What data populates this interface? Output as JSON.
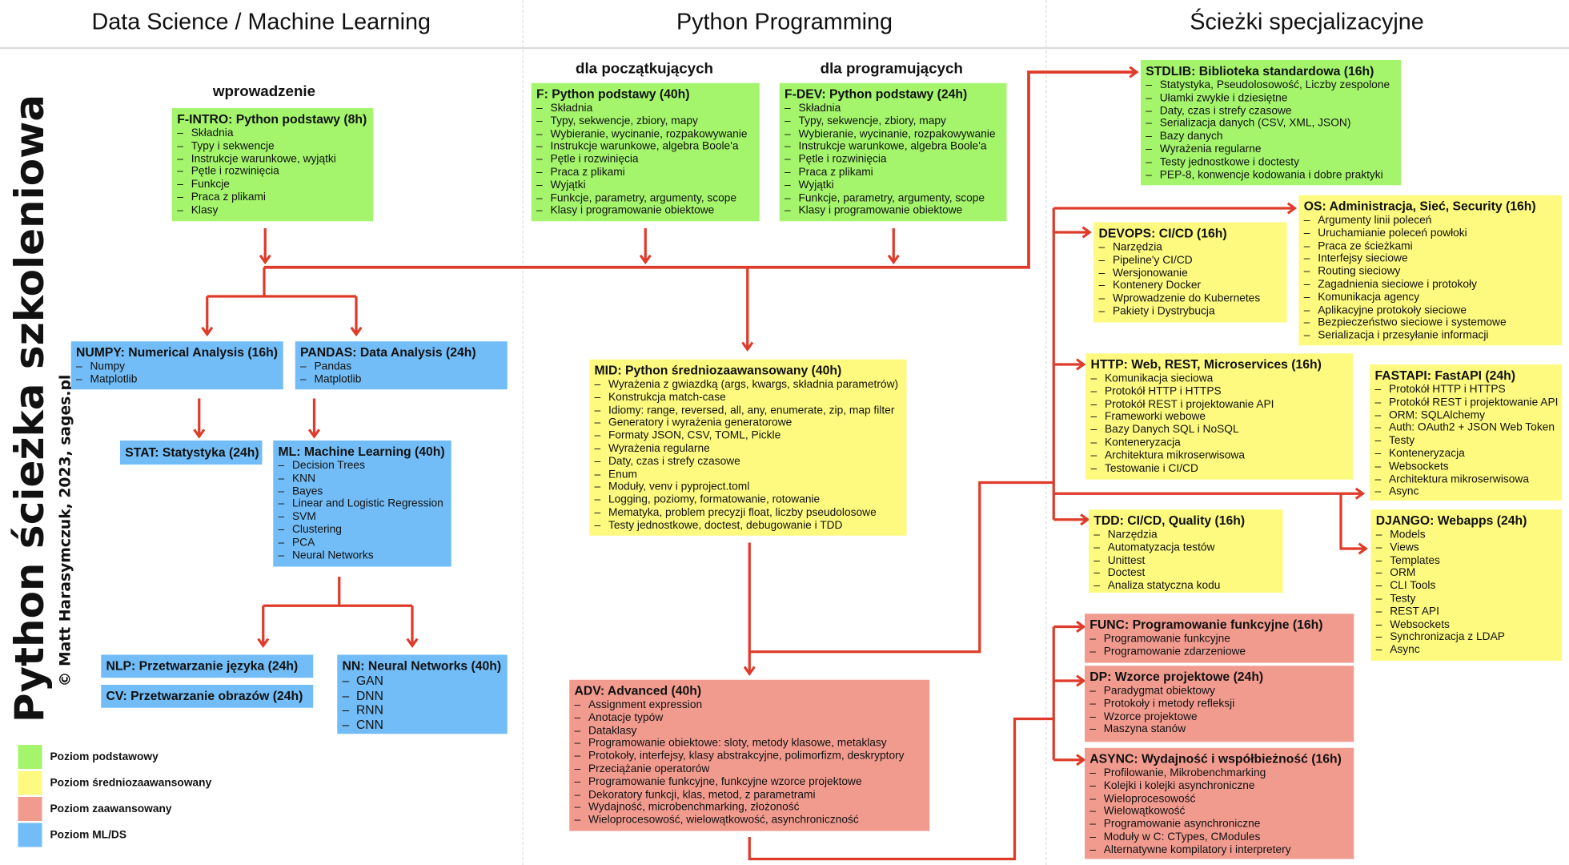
{
  "headers": {
    "data_science": "Data Science / Machine Learning",
    "python": "Python Programming",
    "specializations": "Ścieżki specjalizacyjne"
  },
  "subheaders": {
    "intro": "wprowadzenie",
    "beginners": "dla początkujących",
    "programmers": "dla programujących"
  },
  "side_title": "Python ścieżka szkoleniowa",
  "copyright": "© Matt Harasymczuk, 2023, sages.pl",
  "colors": {
    "basic": "#a4f56c",
    "intermediate": "#fdfa7f",
    "advanced": "#f19b8f",
    "ml_ds": "#72bdf7",
    "arrow": "#df3b2a"
  },
  "legend": [
    {
      "level": "basic",
      "label": "Poziom podstawowy"
    },
    {
      "level": "mid",
      "label": "Poziom średniozaawansowany"
    },
    {
      "level": "adv",
      "label": "Poziom zaawansowany"
    },
    {
      "level": "ml",
      "label": "Poziom ML/DS"
    }
  ],
  "courses": [
    {
      "id": "fintro",
      "level": "basic",
      "title": "F-INTRO: Python podstawy (8h)",
      "items": [
        "Składnia",
        "Typy i sekwencje",
        "Instrukcje warunkowe, wyjątki",
        "Pętle i rozwinięcia",
        "Funkcje",
        "Praca z plikami",
        "Klasy"
      ]
    },
    {
      "id": "f",
      "level": "basic",
      "title": "F: Python podstawy (40h)",
      "items": [
        "Składnia",
        "Typy, sekwencje, zbiory, mapy",
        "Wybieranie, wycinanie, rozpakowywanie",
        "Instrukcje warunkowe, algebra Boole'a",
        "Pętle i rozwinięcia",
        "Praca z plikami",
        "Wyjątki",
        "Funkcje, parametry, argumenty, scope",
        "Klasy i programowanie obiektowe"
      ]
    },
    {
      "id": "fdev",
      "level": "basic",
      "title": "F-DEV: Python podstawy (24h)",
      "items": [
        "Składnia",
        "Typy, sekwencje, zbiory, mapy",
        "Wybieranie, wycinanie, rozpakowywanie",
        "Instrukcje warunkowe, algebra Boole'a",
        "Pętle i rozwinięcia",
        "Praca z plikami",
        "Wyjątki",
        "Funkcje, parametry, argumenty, scope",
        "Klasy i programowanie obiektowe"
      ]
    },
    {
      "id": "stdlib",
      "level": "basic",
      "title": "STDLIB: Biblioteka standardowa (16h)",
      "items": [
        "Statystyka, Pseudolosowość, Liczby zespolone",
        "Ułamki zwykłe i dziesiętne",
        "Daty, czas i strefy czasowe",
        "Serializacja danych (CSV, XML, JSON)",
        "Bazy danych",
        "Wyrażenia regularne",
        "Testy jednostkowe i doctesty",
        "PEP-8, konwencje kodowania i dobre praktyki"
      ]
    },
    {
      "id": "os",
      "level": "mid",
      "title": "OS: Administracja, Sieć, Security (16h)",
      "items": [
        "Argumenty linii poleceń",
        "Uruchamianie poleceń powłoki",
        "Praca ze ścieżkami",
        "Interfejsy sieciowe",
        "Routing sieciowy",
        "Zagadnienia sieciowe i protokoły",
        "Komunikacja agency",
        "Aplikacyjne protokoły sieciowe",
        "Bezpieczeństwo sieciowe i systemowe",
        "Serializacja i przesyłanie informacji"
      ]
    },
    {
      "id": "devops",
      "level": "mid",
      "title": "DEVOPS: CI/CD (16h)",
      "items": [
        "Narzędzia",
        "Pipeline'y CI/CD",
        "Wersjonowanie",
        "Kontenery Docker",
        "Wprowadzenie do Kubernetes",
        "Pakiety i Dystrybucja"
      ]
    },
    {
      "id": "http",
      "level": "mid",
      "title": "HTTP: Web, REST, Microservices (16h)",
      "items": [
        "Komunikacja sieciowa",
        "Protokół HTTP i HTTPS",
        "Protokół REST i projektowanie API",
        "Frameworki webowe",
        "Bazy Danych SQL i NoSQL",
        "Konteneryzacja",
        "Architektura mikroserwisowa",
        "Testowanie i CI/CD"
      ]
    },
    {
      "id": "fastapi",
      "level": "mid",
      "title": "FASTAPI: FastAPI (24h)",
      "items": [
        "Protokół HTTP i HTTPS",
        "Protokół REST i projektowanie API",
        "ORM: SQLAlchemy",
        "Auth: OAuth2 + JSON Web Token",
        "Testy",
        "Konteneryzacja",
        "Websockets",
        "Architektura mikroserwisowa",
        "Async"
      ]
    },
    {
      "id": "tdd",
      "level": "mid",
      "title": "TDD: CI/CD, Quality (16h)",
      "items": [
        "Narzędzia",
        "Automatyzacja testów",
        "Unittest",
        "Doctest",
        "Analiza statyczna kodu"
      ]
    },
    {
      "id": "django",
      "level": "mid",
      "title": "DJANGO: Webapps (24h)",
      "items": [
        "Models",
        "Views",
        "Templates",
        "ORM",
        "CLI Tools",
        "Testy",
        "REST API",
        "Websockets",
        "Synchronizacja z LDAP",
        "Async"
      ]
    },
    {
      "id": "func",
      "level": "adv",
      "title": "FUNC: Programowanie funkcyjne (16h)",
      "items": [
        "Programowanie funkcyjne",
        "Programowanie zdarzeniowe"
      ]
    },
    {
      "id": "dp",
      "level": "adv",
      "title": "DP: Wzorce projektowe (24h)",
      "items": [
        "Paradygmat obiektowy",
        "Protokoły i metody refleksji",
        "Wzorce projektowe",
        "Maszyna stanów"
      ]
    },
    {
      "id": "async",
      "level": "adv",
      "title": "ASYNC: Wydajność i współbieżność (16h)",
      "items": [
        "Profilowanie, Mikrobenchmarking",
        "Kolejki i kolejki asynchroniczne",
        "Wieloprocesowość",
        "Wielowątkowość",
        "Programowanie asynchroniczne",
        "Moduły w C: CTypes, CModules",
        "Alternatywne kompilatory i interpretery"
      ]
    },
    {
      "id": "mid",
      "level": "mid",
      "title": "MID: Python średniozaawansowany (40h)",
      "items": [
        "Wyrażenia z gwiazdką (args, kwargs, składnia parametrów)",
        "Konstrukcja match-case",
        "Idiomy: range, reversed, all, any, enumerate, zip, map filter",
        "Generatory i wyrażenia generatorowe",
        "Formaty JSON, CSV, TOML, Pickle",
        "Wyrażenia regularne",
        "Daty, czas i strefy czasowe",
        "Enum",
        "Moduły, venv i pyproject.toml",
        "Logging, poziomy, formatowanie, rotowanie",
        "Mematyka, problem precyzji float, liczby pseudolosowe",
        "Testy jednostkowe, doctest, debugowanie i TDD"
      ]
    },
    {
      "id": "adv",
      "level": "adv",
      "title": "ADV: Advanced (40h)",
      "items": [
        "Assignment expression",
        "Anotacje typów",
        "Dataklasy",
        "Programowanie obiektowe: sloty, metody klasowe, metaklasy",
        "Protokoły, interfejsy, klasy abstrakcyjne, polimorfizm, deskryptory",
        "Przeciążanie operatorów",
        "Programowanie funkcyjne, funkcyjne wzorce projektowe",
        "Dekoratory funkcji, klas, metod, z parametrami",
        "Wydajność, microbenchmarking, złożoność",
        "Wieloprocesowość, wielowątkowość, asynchroniczność"
      ]
    },
    {
      "id": "numpy",
      "level": "ml",
      "title": "NUMPY: Numerical Analysis (16h)",
      "items": [
        "Numpy",
        "Matplotlib"
      ]
    },
    {
      "id": "pandas",
      "level": "ml",
      "title": "PANDAS: Data Analysis (24h)",
      "items": [
        "Pandas",
        "Matplotlib"
      ]
    },
    {
      "id": "stat",
      "level": "ml",
      "title": "STAT: Statystyka (24h)",
      "items": []
    },
    {
      "id": "ml",
      "level": "ml",
      "title": "ML: Machine Learning (40h)",
      "items": [
        "Decision Trees",
        "KNN",
        "Bayes",
        "Linear and Logistic Regression",
        "SVM",
        "Clustering",
        "PCA",
        "Neural Networks"
      ]
    },
    {
      "id": "nlp",
      "level": "ml",
      "title": "NLP: Przetwarzanie języka (24h)",
      "items": []
    },
    {
      "id": "cv",
      "level": "ml",
      "title": "CV: Przetwarzanie obrazów (24h)",
      "items": []
    },
    {
      "id": "nn",
      "level": "ml",
      "title": "NN: Neural Networks (40h)",
      "items": [
        "GAN",
        "DNN",
        "RNN",
        "CNN"
      ]
    }
  ]
}
